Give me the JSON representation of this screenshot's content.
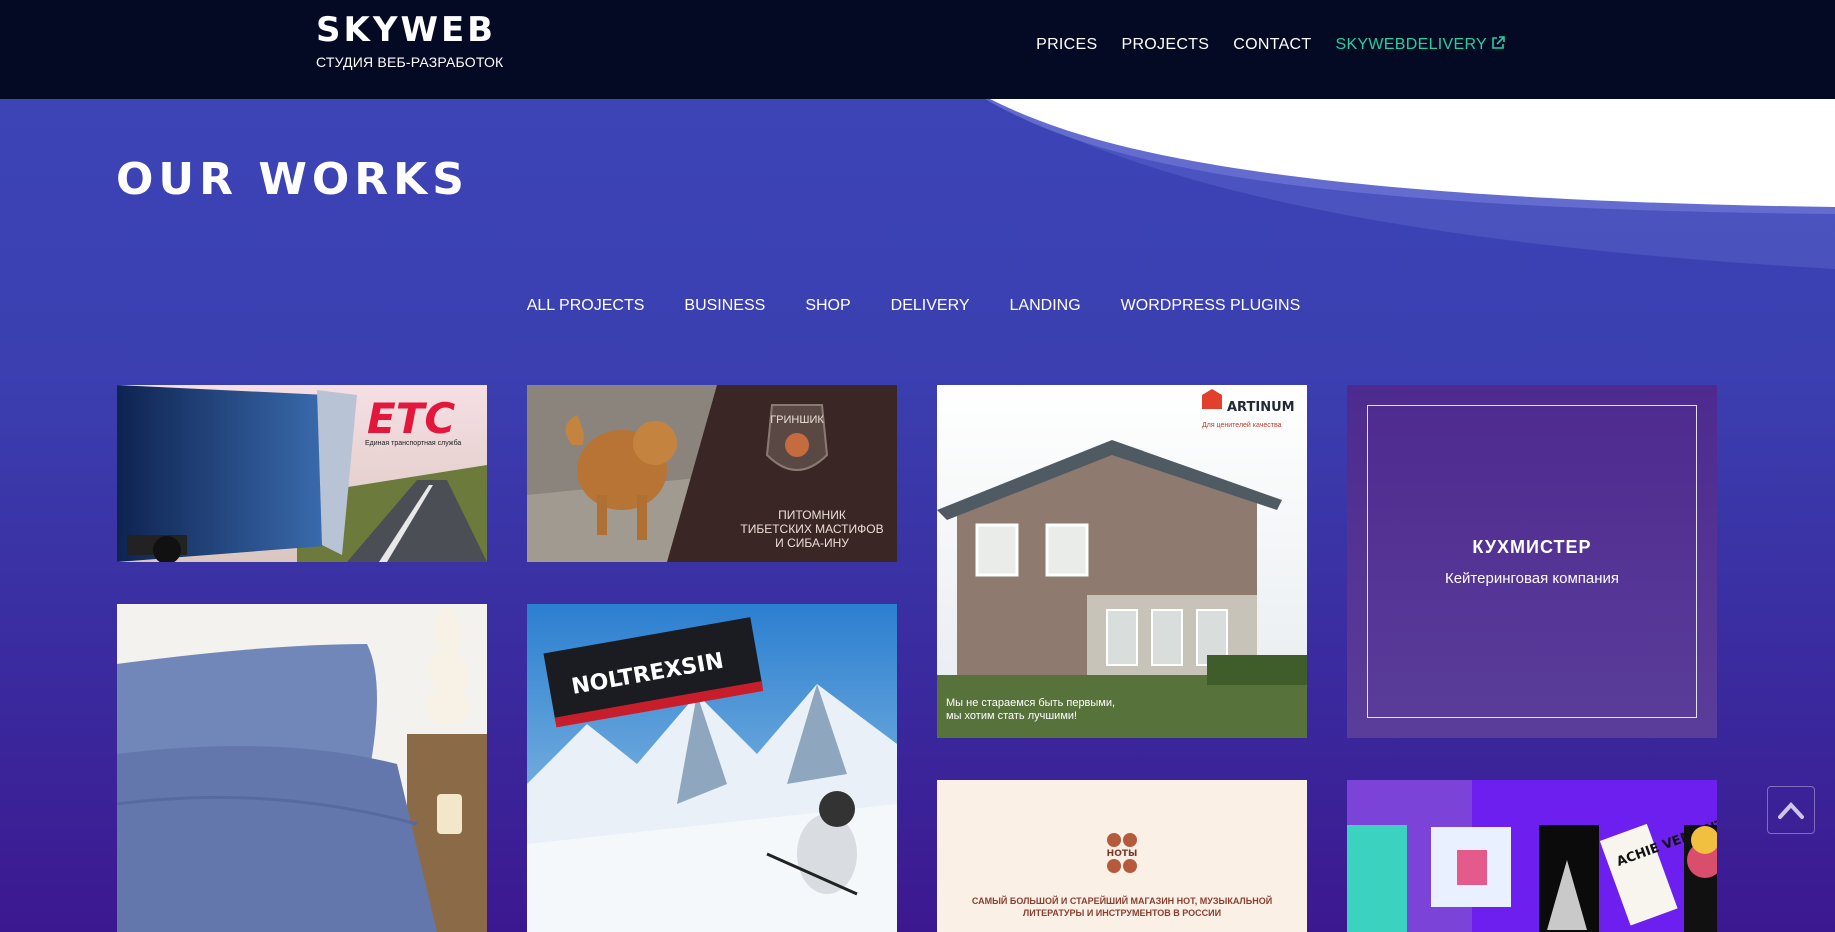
{
  "brand": {
    "title": "SKYWEB",
    "subtitle": "СТУДИЯ ВЕБ-РАЗРАБОТОК"
  },
  "nav": {
    "items": [
      "PRICES",
      "PROJECTS",
      "CONTACT"
    ],
    "external": "SKYWEBDELIVERY",
    "external_icon": "external-link-icon",
    "accent_color": "#21d1a0"
  },
  "page": {
    "title": "OUR WORKS"
  },
  "filters": [
    "ALL PROJECTS",
    "BUSINESS",
    "SHOP",
    "DELIVERY",
    "LANDING",
    "WORDPRESS PLUGINS"
  ],
  "projects": {
    "etc": {
      "logo": "ETC",
      "tagline": "Единая транспортная служба"
    },
    "grinshik": {
      "brand": "ГРИНШИК",
      "line1": "ПИТОМНИК",
      "line2": "ТИБЕТСКИХ МАСТИФОВ",
      "line3": "И СИБА-ИНУ"
    },
    "artinum": {
      "brand": "ARTINUM",
      "tagline": "Для ценителей качества",
      "caption1": "Мы не стараемся быть первыми,",
      "caption2": "мы хотим стать лучшими!"
    },
    "kuxmister": {
      "title": "КУХМИСТЕР",
      "subtitle": "Кейтеринговая компания"
    },
    "noltrexsin": {
      "brand": "NOLTREXSIN"
    },
    "noty": {
      "brand": "НОТЫ",
      "line1": "САМЫЙ БОЛЬШОЙ И СТАРЕЙШИЙ МАГАЗИН НОТ, МУЗЫКАЛЬНОЙ",
      "line2": "ЛИТЕРАТУРЫ И ИНСТРУМЕНТОВ В РОССИИ"
    },
    "poster": {
      "text": "ACHIE VEME NTS"
    }
  },
  "scroll_top_icon": "chevron-up-icon"
}
